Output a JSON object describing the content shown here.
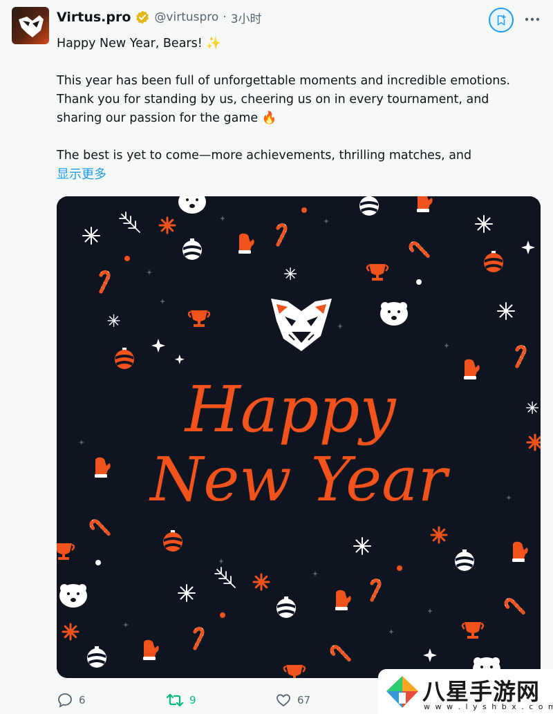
{
  "tweet": {
    "author_name": "Virtus.pro",
    "handle": "@virtuspro",
    "separator": "·",
    "time": "3小时",
    "lines": [
      "Happy New Year, Bears! ✨",
      "This year has been full of unforgettable moments and incredible emotions.",
      "Thank you for standing by us, cheering us on in every tournament, and",
      "sharing our passion for the game 🔥",
      "The best is yet to come—more achievements, thrilling matches, and"
    ],
    "show_more": "显示更多"
  },
  "media": {
    "greeting_line1": "Happy",
    "greeting_line2": "New Year"
  },
  "actions": {
    "replies": "6",
    "retweets": "9",
    "likes": "67"
  },
  "watermark": {
    "text": "八星手游网",
    "url": "w w w . l y s h b x . c o m"
  },
  "colors": {
    "accent": "#1d9bf0",
    "retweet": "#00ba7c",
    "card_bg": "#0e1521",
    "orange": "#f2521c"
  }
}
